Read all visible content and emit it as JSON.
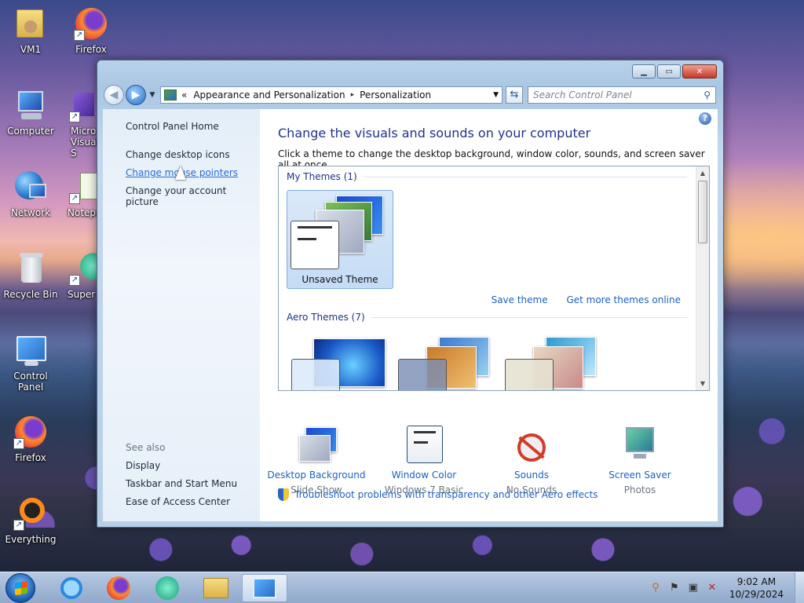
{
  "desktop": {
    "icons": [
      {
        "label": "VM1"
      },
      {
        "label": "Firefox"
      },
      {
        "label": "Computer"
      },
      {
        "label": "Micro Visual S"
      },
      {
        "label": "Network"
      },
      {
        "label": "Notepa"
      },
      {
        "label": "Recycle Bin"
      },
      {
        "label": "Super"
      },
      {
        "label": "Control Panel"
      },
      {
        "label": "Firefox"
      },
      {
        "label": "Everything"
      }
    ]
  },
  "window": {
    "address": {
      "prefix": "«",
      "crumb1": "Appearance and Personalization",
      "separator": "▸",
      "crumb2": "Personalization"
    },
    "search_placeholder": "Search Control Panel",
    "left": {
      "home": "Control Panel Home",
      "links": [
        "Change desktop icons",
        "Change mouse pointers",
        "Change your account picture"
      ],
      "see_also_title": "See also",
      "see_also": [
        "Display",
        "Taskbar and Start Menu",
        "Ease of Access Center"
      ]
    },
    "main": {
      "title": "Change the visuals and sounds on your computer",
      "subtitle": "Click a theme to change the desktop background, window color, sounds, and screen saver all at once.",
      "my_themes": "My Themes (1)",
      "unsaved_theme": "Unsaved Theme",
      "save_theme": "Save theme",
      "get_more": "Get more themes online",
      "aero_themes": "Aero Themes (7)",
      "bottom": [
        {
          "name": "Desktop Background",
          "value": "Slide Show"
        },
        {
          "name": "Window Color",
          "value": "Windows 7 Basic"
        },
        {
          "name": "Sounds",
          "value": "No Sounds"
        },
        {
          "name": "Screen Saver",
          "value": "Photos"
        }
      ],
      "troubleshoot": "Troubleshoot problems with transparency and other Aero effects"
    }
  },
  "taskbar": {
    "time": "9:02 AM",
    "date": "10/29/2024"
  }
}
